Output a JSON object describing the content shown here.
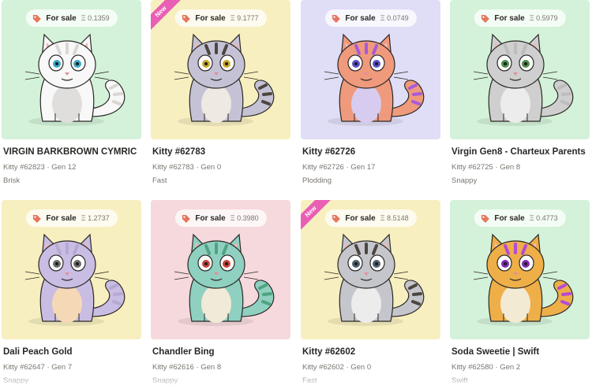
{
  "cards": [
    {
      "id": "k1",
      "bg": "#d4f2d9",
      "sale_label": "For sale",
      "price": "Ξ 0.1359",
      "name": "VIRGIN BARKBROWN CYMRIC",
      "meta": "Kitty #62823 · Gen 12",
      "speed": "Brisk",
      "is_new": false,
      "ribbon": "",
      "body": "#f8f8f8",
      "belly": "#e0dedd",
      "stripe": "#d9d6d4",
      "eye": "#3aa9c6"
    },
    {
      "id": "k2",
      "bg": "#f8efc0",
      "sale_label": "For sale",
      "price": "Ξ 9.1777",
      "name": "Kitty #62783",
      "meta": "Kitty #62783 · Gen 0",
      "speed": "Fast",
      "is_new": true,
      "ribbon": "New",
      "body": "#c6c2d6",
      "belly": "#efe9e3",
      "stripe": "#4d4640",
      "eye": "#c9a62a"
    },
    {
      "id": "k3",
      "bg": "#e0ddf6",
      "sale_label": "For sale",
      "price": "Ξ 0.0749",
      "name": "Kitty #62726",
      "meta": "Kitty #62726 · Gen 17",
      "speed": "Plodding",
      "is_new": false,
      "ribbon": "",
      "body": "#ef9a7c",
      "belly": "#d7ccf0",
      "stripe": "#a85ad8",
      "eye": "#5b4ec8"
    },
    {
      "id": "k4",
      "bg": "#d4f2d9",
      "sale_label": "For sale",
      "price": "Ξ 0.5979",
      "name": "Virgin Gen8 - Charteux Parents",
      "meta": "Kitty #62725 · Gen 8",
      "speed": "Snappy",
      "is_new": false,
      "ribbon": "",
      "body": "#cfcfcf",
      "belly": "#ececec",
      "stripe": "#bdbdbd",
      "eye": "#4d8c4a"
    },
    {
      "id": "k5",
      "bg": "#f8efc0",
      "sale_label": "For sale",
      "price": "Ξ 1.2737",
      "name": "Dali Peach Gold",
      "meta": "Kitty #62647 · Gen 7",
      "speed": "Snappy",
      "is_new": false,
      "ribbon": "",
      "body": "#c9bde3",
      "belly": "#f5d9b7",
      "stripe": "#b5a9d3",
      "eye": "#6c6c6c"
    },
    {
      "id": "k6",
      "bg": "#f6d9dc",
      "sale_label": "For sale",
      "price": "Ξ 0.3980",
      "name": "Chandler Bing",
      "meta": "Kitty #62616 · Gen 8",
      "speed": "Snappy",
      "is_new": false,
      "ribbon": "",
      "body": "#8fd0c0",
      "belly": "#f1ead8",
      "stripe": "#4fa382",
      "eye": "#c6443a"
    },
    {
      "id": "k7",
      "bg": "#f8efc0",
      "sale_label": "For sale",
      "price": "Ξ 8.5148",
      "name": "Kitty #62602",
      "meta": "Kitty #62602 · Gen 0",
      "speed": "Fast",
      "is_new": true,
      "ribbon": "New",
      "body": "#c4c6cb",
      "belly": "#ececec",
      "stripe": "#4d4640",
      "eye": "#4e5d6e"
    },
    {
      "id": "k8",
      "bg": "#d4f2d9",
      "sale_label": "For sale",
      "price": "Ξ 0.4773",
      "name": "Soda Sweetie | Swift",
      "meta": "Kitty #62580 · Gen 2",
      "speed": "Swift",
      "is_new": false,
      "ribbon": "",
      "body": "#eeae48",
      "belly": "#f2ead3",
      "stripe": "#b64ad8",
      "eye": "#7d2bb0"
    }
  ],
  "colors": {
    "tag_icon": "#e4775f",
    "ribbon": "#e95fb4",
    "name_text": "#2a2825",
    "meta_text": "#7a7670"
  },
  "icons": {
    "tag": "price-tag-icon"
  }
}
